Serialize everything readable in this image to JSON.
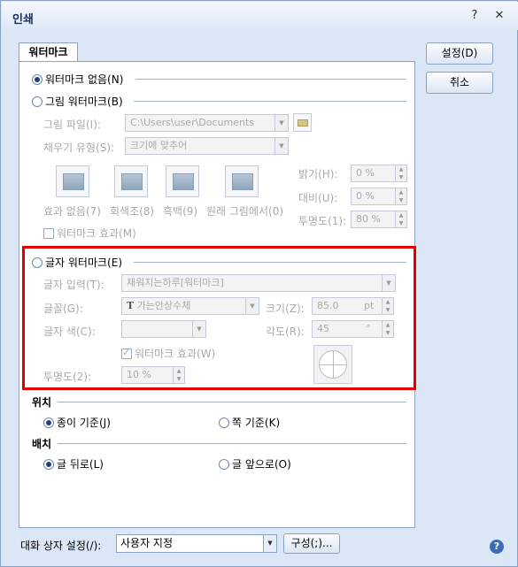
{
  "window": {
    "title": "인쇄",
    "help_glyph": "?",
    "close_glyph": "✕"
  },
  "tab": {
    "label": "워터마크"
  },
  "buttons": {
    "ok": "설정(D)",
    "cancel": "취소"
  },
  "options": {
    "none": "워터마크 없음(N)",
    "picture": "그림 워터마크(B)",
    "text": "글자 워터마크(E)"
  },
  "picture": {
    "file_label": "그림 파일(I):",
    "file_value": "C:\\Users\\user\\Documents",
    "fill_label": "채우기 유형(S):",
    "fill_value": "크기에 맞추어",
    "effects": [
      "효과 없음(7)",
      "회색조(8)",
      "흑백(9)",
      "원래 그림에서(0)"
    ],
    "brightness_label": "밝기(H):",
    "brightness_value": "0 %",
    "contrast_label": "대비(U):",
    "contrast_value": "0 %",
    "transparency_label": "투명도(1):",
    "transparency_value": "80 %",
    "effect_check": "워터마크 효과(M)"
  },
  "text": {
    "input_label": "글자 입력(T):",
    "input_value": "채워지는하루[워터마크]",
    "font_label": "글꼴(G):",
    "font_value": "가는안상수체",
    "size_label": "크기(Z):",
    "size_value": "85.0",
    "size_unit": "pt",
    "color_label": "글자 색(C):",
    "angle_label": "각도(R):",
    "angle_value": "45",
    "angle_unit": "°",
    "effect_check": "워터마크 효과(W)",
    "transparency_label": "투명도(2):",
    "transparency_value": "10 %"
  },
  "position": {
    "heading": "위치",
    "paper": "종이 기준(J)",
    "page": "쪽 기준(K)"
  },
  "placement": {
    "heading": "배치",
    "behind": "글 뒤로(L)",
    "front": "글 앞으로(O)"
  },
  "footer": {
    "settings_label": "대화 상자 설정(/):",
    "settings_value": "사용자 지정",
    "config_button": "구성(;)...",
    "help_glyph": "?"
  }
}
